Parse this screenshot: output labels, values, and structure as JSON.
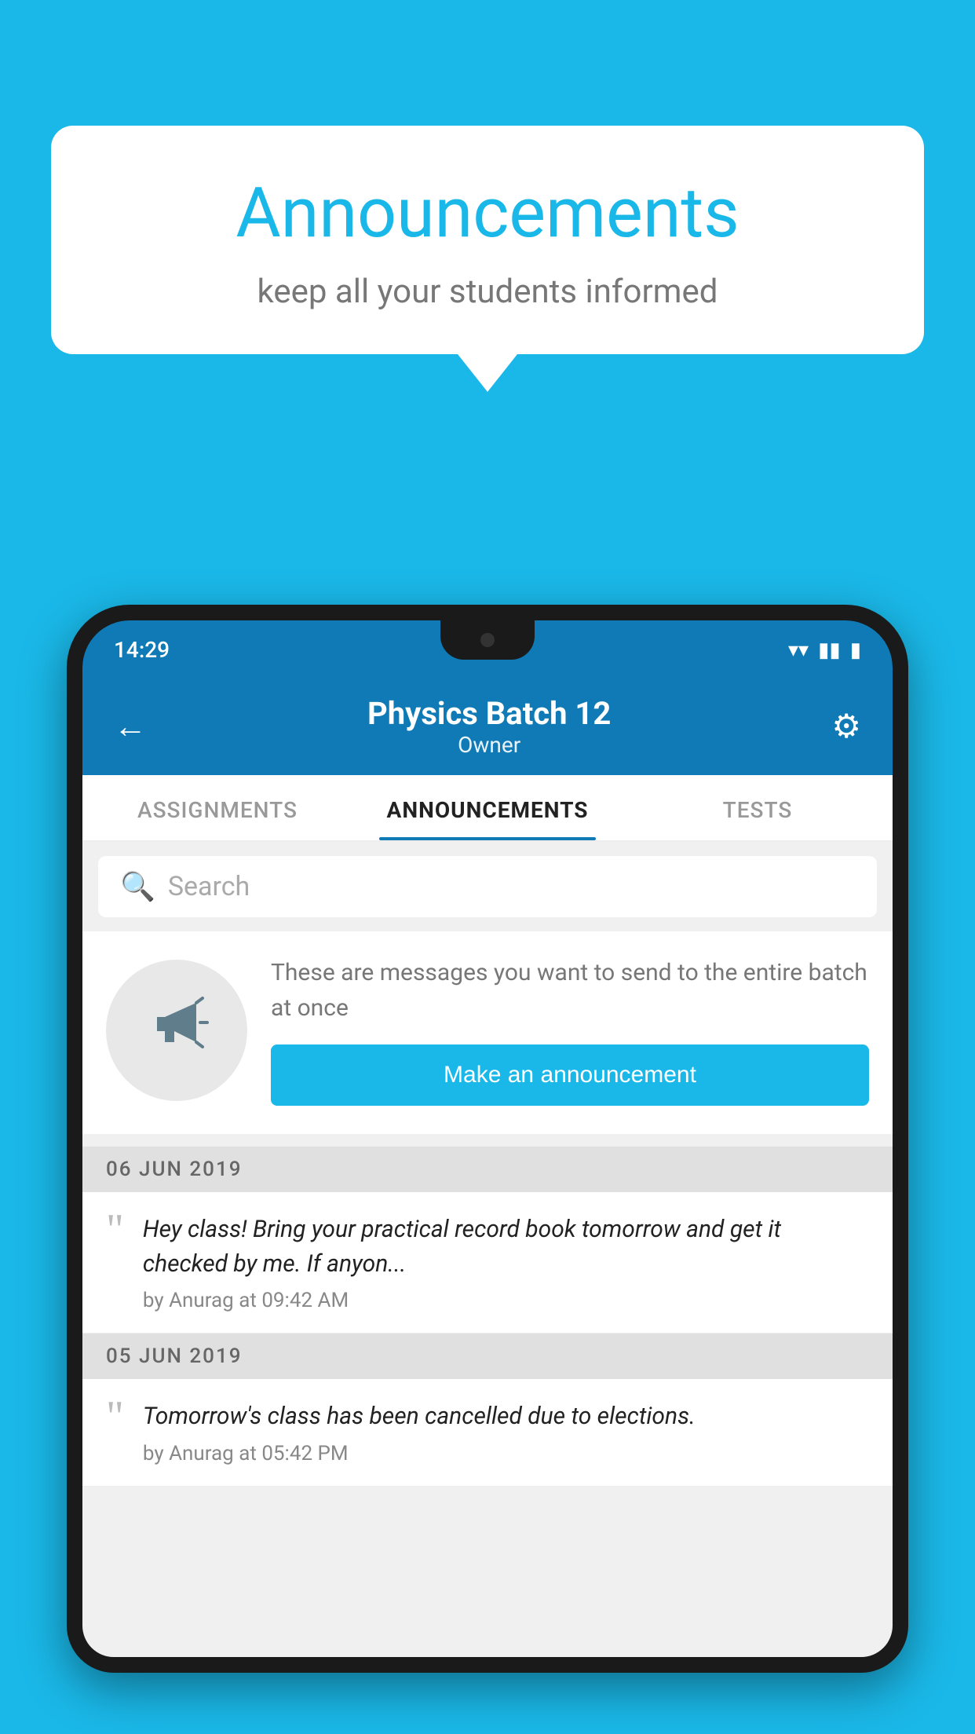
{
  "background_color": "#1ab8e8",
  "speech_bubble": {
    "title": "Announcements",
    "subtitle": "keep all your students informed"
  },
  "phone": {
    "status_bar": {
      "time": "14:29",
      "icons": [
        "▼",
        "◂▸",
        "▮"
      ]
    },
    "header": {
      "title": "Physics Batch 12",
      "subtitle": "Owner",
      "back_label": "←",
      "gear_label": "⚙"
    },
    "tabs": [
      {
        "label": "ASSIGNMENTS",
        "active": false
      },
      {
        "label": "ANNOUNCEMENTS",
        "active": true
      },
      {
        "label": "TESTS",
        "active": false
      }
    ],
    "search": {
      "placeholder": "Search"
    },
    "promo": {
      "description": "These are messages you want to send to the entire batch at once",
      "button_label": "Make an announcement"
    },
    "announcements": [
      {
        "date": "06  JUN  2019",
        "text": "Hey class! Bring your practical record book tomorrow and get it checked by me. If anyon...",
        "meta": "by Anurag at 09:42 AM"
      },
      {
        "date": "05  JUN  2019",
        "text": "Tomorrow's class has been cancelled due to elections.",
        "meta": "by Anurag at 05:42 PM"
      }
    ]
  }
}
